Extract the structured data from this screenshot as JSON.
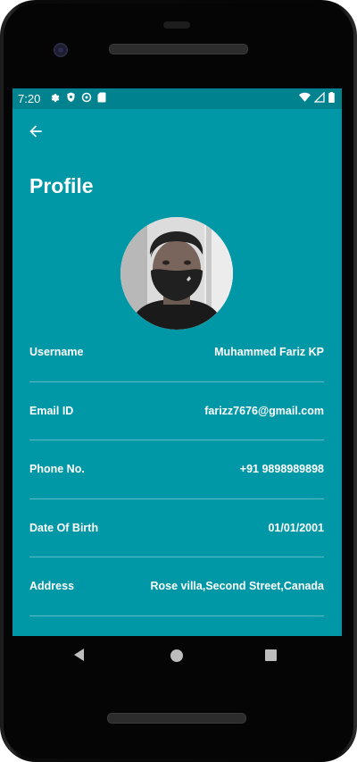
{
  "status_bar": {
    "time": "7:20",
    "left_icons": [
      "gear-icon",
      "shield-icon",
      "sync-icon",
      "sd-card-icon"
    ],
    "right_icons": [
      "wifi-icon",
      "signal-icon",
      "battery-icon"
    ]
  },
  "app_bar": {
    "back_icon": "arrow-left-icon"
  },
  "page": {
    "title": "Profile"
  },
  "profile": {
    "fields": [
      {
        "label": "Username",
        "value": "Muhammed Fariz KP"
      },
      {
        "label": "Email ID",
        "value": "farizz7676@gmail.com"
      },
      {
        "label": "Phone No.",
        "value": "+91 9898989898"
      },
      {
        "label": "Date Of Birth",
        "value": "01/01/2001"
      },
      {
        "label": "Address",
        "value": "Rose villa,Second Street,Canada"
      }
    ]
  },
  "colors": {
    "primary": "#0097a7",
    "status_bar": "#00838f",
    "text": "#ffffff"
  }
}
